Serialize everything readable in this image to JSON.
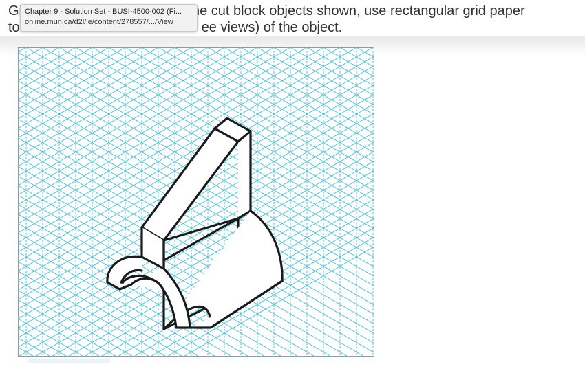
{
  "question": {
    "line1_start": "Gi",
    "line1_end": "he cut block objects shown, use rectangular grid paper",
    "line2_start": "to",
    "line2_end": "ee views) of the object."
  },
  "tooltip": {
    "title": "Chapter 9 - Solution Set - BUSI-4500-002 (Fi...",
    "url": "online.mun.ca/d2l/le/content/278557/.../View"
  },
  "figure": {
    "grid_color": "#4fc3d9",
    "line_color": "#1a1a1a",
    "background": "#ffffff"
  }
}
